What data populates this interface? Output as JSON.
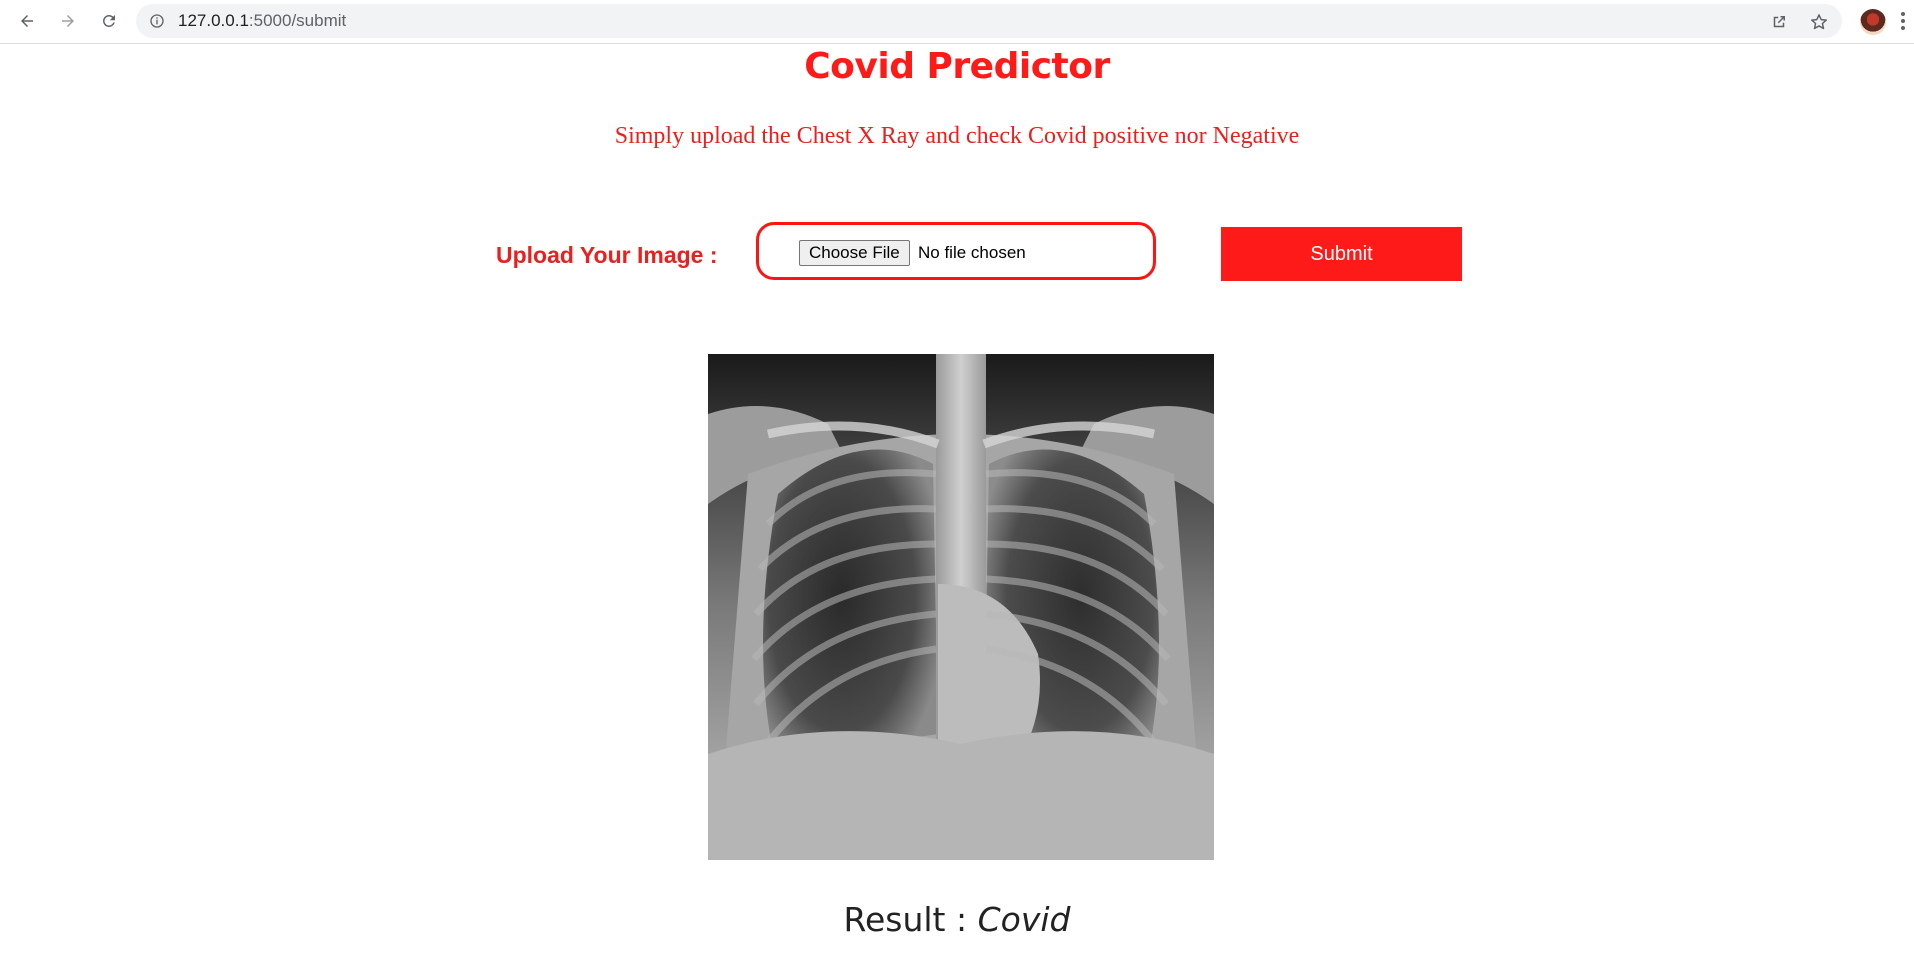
{
  "browser": {
    "url_host": "127.0.0.1",
    "url_path": ":5000/submit"
  },
  "page": {
    "title": "Covid Predictor",
    "subtitle": "Simply upload the Chest X Ray and check Covid positive nor Negative"
  },
  "upload_form": {
    "label": "Upload Your Image :",
    "choose_file_label": "Choose File",
    "file_status": "No file chosen",
    "submit_label": "Submit"
  },
  "result": {
    "label": "Result :",
    "value": "Covid"
  },
  "icons": {
    "back": "back-arrow-icon",
    "forward": "forward-arrow-icon",
    "reload": "reload-icon",
    "info": "info-icon",
    "share": "share-icon",
    "bookmark": "star-icon",
    "profile": "avatar",
    "menu": "kebab-menu-icon"
  },
  "colors": {
    "accent": "#ff1a1a",
    "subtitle": "#e8201e"
  }
}
